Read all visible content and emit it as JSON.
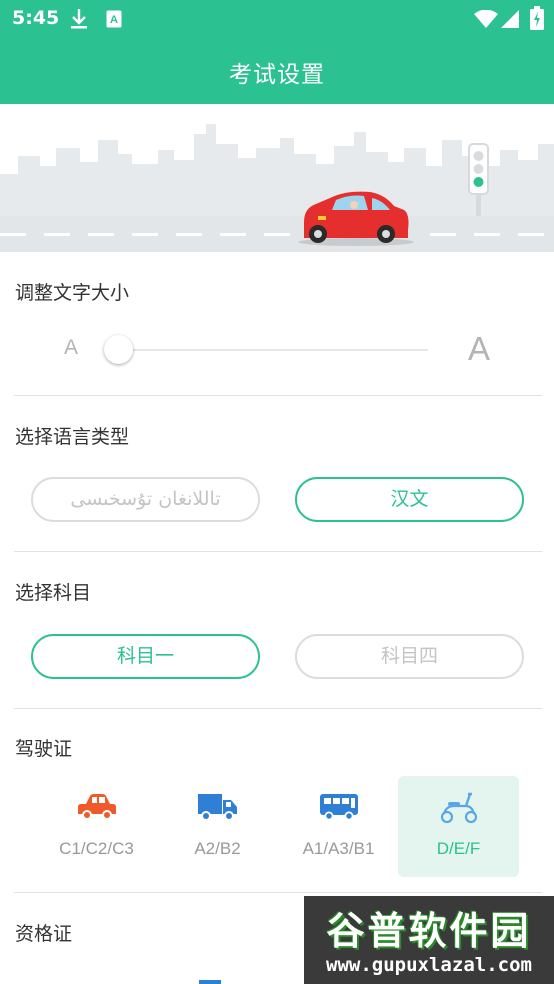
{
  "status_bar": {
    "time": "5:45"
  },
  "app_bar": {
    "title": "考试设置"
  },
  "font_size": {
    "title": "调整文字大小",
    "small_label": "A",
    "large_label": "A",
    "level": 0
  },
  "language": {
    "title": "选择语言类型",
    "options": [
      {
        "label": "تاللانغان تۇسخىسى",
        "selected": false
      },
      {
        "label": "汉文",
        "selected": true
      }
    ]
  },
  "subject": {
    "title": "选择科目",
    "options": [
      {
        "label": "科目一",
        "selected": true
      },
      {
        "label": "科目四",
        "selected": false
      }
    ]
  },
  "license": {
    "title": "驾驶证",
    "options": [
      {
        "label": "C1/C2/C3",
        "icon": "car-icon",
        "color": "#f0592a",
        "selected": false
      },
      {
        "label": "A2/B2",
        "icon": "truck-icon",
        "color": "#2f7fd6",
        "selected": false
      },
      {
        "label": "A1/A3/B1",
        "icon": "bus-icon",
        "color": "#2f7fd6",
        "selected": false
      },
      {
        "label": "D/E/F",
        "icon": "scooter-icon",
        "color": "#5aa7e6",
        "selected": true
      }
    ]
  },
  "qualification": {
    "title": "资格证"
  },
  "watermark": {
    "brand": "谷普软件园",
    "url": "www.gupuxlazal.com"
  },
  "colors": {
    "primary": "#2cc190",
    "selected_bg": "#e3f5ee",
    "muted": "#999999"
  }
}
